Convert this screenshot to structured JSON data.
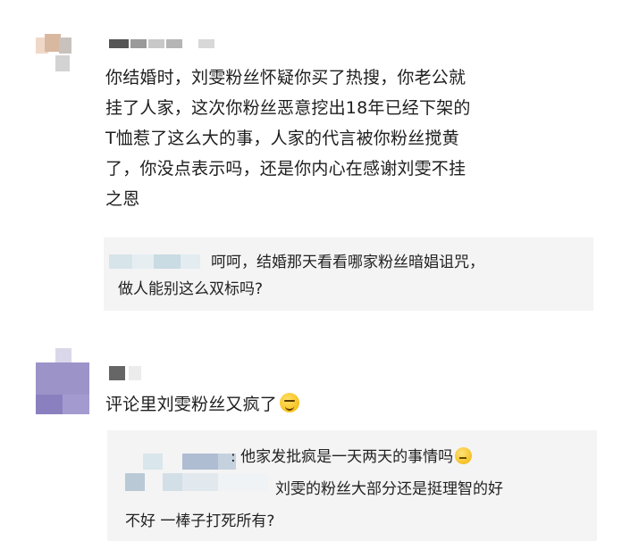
{
  "comments": [
    {
      "text_lines": [
        "你结婚时，刘雯粉丝怀疑你买了热搜，你老公就",
        "挂了人家，这次你粉丝恶意挖出18年已经下架的",
        "T恤惹了这么大的事，人家的代言被你粉丝搅黄",
        "了，你没点表示吗，还是你内心在感谢刘雯不挂",
        "之恩"
      ],
      "reply": {
        "lines": [
          "呵呵，结婚那天看看哪家粉丝暗娼诅咒，",
          "做人能别这么双标吗?"
        ]
      }
    },
    {
      "text": "评论里刘雯粉丝又疯了",
      "emoji": "smug-emoji-icon",
      "replies": [
        {
          "text": ": 他家发批疯是一天两天的事情吗",
          "emoji": "thinking-emoji-icon"
        },
        {
          "text": "刘雯的粉丝大部分还是挺理智的好"
        },
        {
          "text": "不好  一棒子打死所有?"
        }
      ]
    }
  ],
  "colors": {
    "background": "#ffffff",
    "reply_background": "#f4f4f4",
    "text": "#1e1e1e"
  }
}
